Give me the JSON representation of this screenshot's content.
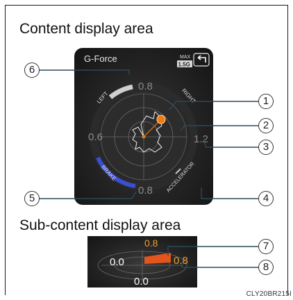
{
  "headings": {
    "content_area": "Content display area",
    "sub_content_area": "Sub-content display area"
  },
  "gforce": {
    "title": "G-Force",
    "max_label": "MAX",
    "max_value": "1.5G",
    "back_icon": "return-arrow-icon",
    "labels": {
      "left": "LEFT",
      "right": "RIGHT",
      "brake": "BRAKE",
      "accelerator": "ACCELERATOR"
    },
    "scale": {
      "top": "0.8",
      "left": "0.6",
      "right": "1.2",
      "bottom": "0.8"
    },
    "colors": {
      "brake_arc": "#3a4fd6",
      "current_dot": "#f07a12",
      "max_arc": "#cfcfcf"
    }
  },
  "sub": {
    "top_value": "0.8",
    "left_value": "0.0",
    "right_value": "0.8",
    "bottom_value": "0.0",
    "colors": {
      "highlight": "#f0a02a",
      "bar": "#e2551d"
    }
  },
  "callouts": [
    "1",
    "2",
    "3",
    "4",
    "5",
    "6",
    "7",
    "8"
  ],
  "reference_code": "CLY20BR215I"
}
